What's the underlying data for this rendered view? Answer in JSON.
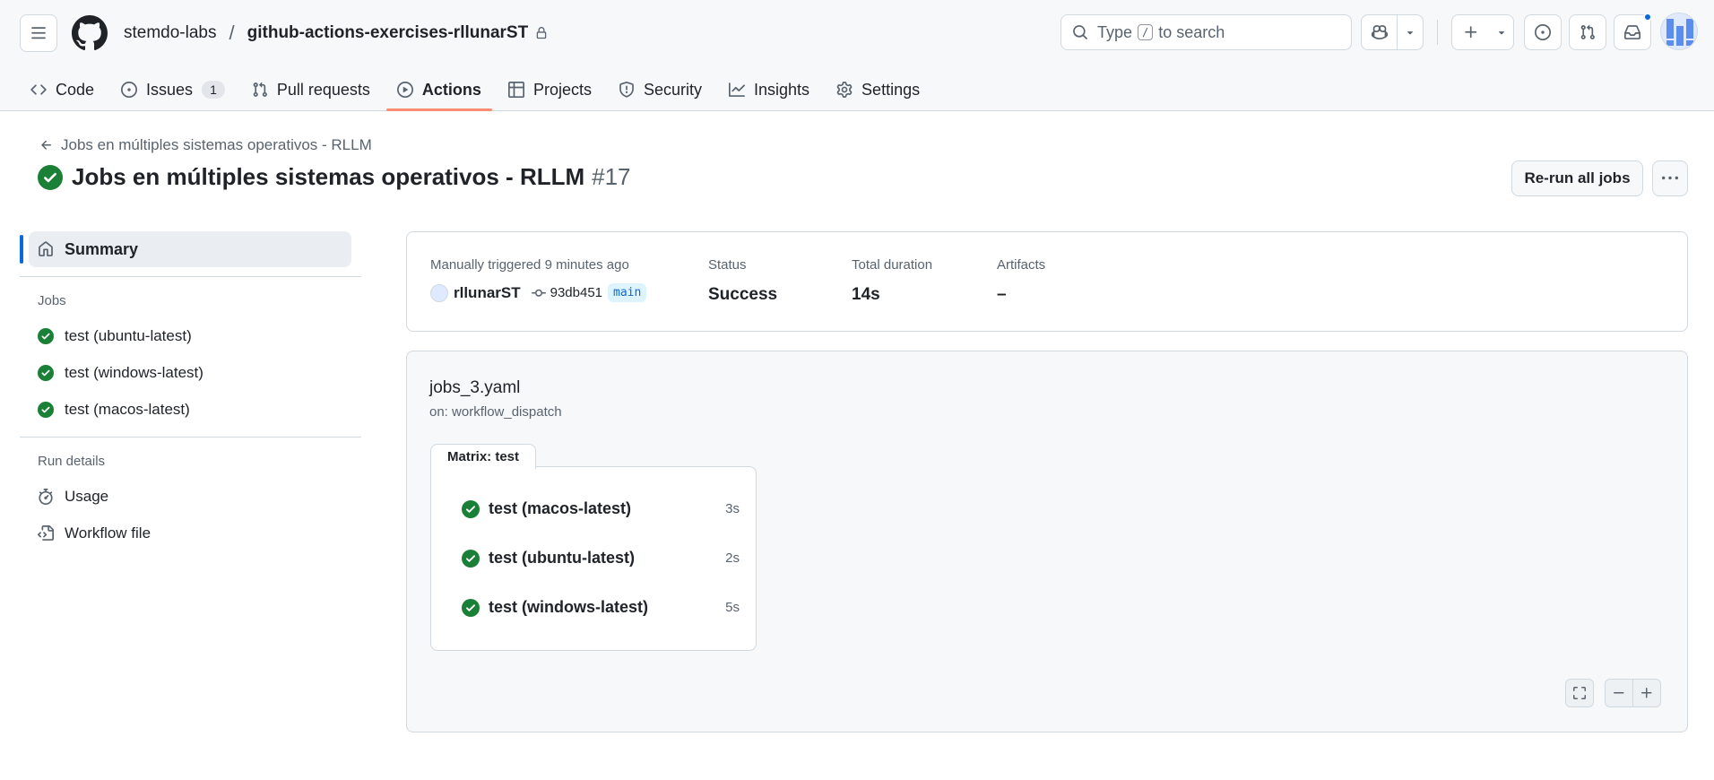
{
  "header": {
    "owner": "stemdo-labs",
    "separator": "/",
    "repo": "github-actions-exercises-rllunarST",
    "search_prefix": "Type",
    "search_key": "/",
    "search_suffix": "to search"
  },
  "tabs": [
    {
      "label": "Code",
      "icon": "code-icon"
    },
    {
      "label": "Issues",
      "icon": "issue-icon",
      "count": "1"
    },
    {
      "label": "Pull requests",
      "icon": "pull-request-icon"
    },
    {
      "label": "Actions",
      "icon": "play-icon",
      "active": true
    },
    {
      "label": "Projects",
      "icon": "table-icon"
    },
    {
      "label": "Security",
      "icon": "shield-icon"
    },
    {
      "label": "Insights",
      "icon": "graph-icon"
    },
    {
      "label": "Settings",
      "icon": "gear-icon"
    }
  ],
  "run": {
    "back_label": "Jobs en múltiples sistemas operativos - RLLM",
    "title": "Jobs en múltiples sistemas operativos - RLLM",
    "number": "#17",
    "rerun_label": "Re-run all jobs"
  },
  "sidebar": {
    "summary_label": "Summary",
    "jobs_heading": "Jobs",
    "jobs": [
      "test (ubuntu-latest)",
      "test (windows-latest)",
      "test (macos-latest)"
    ],
    "details_heading": "Run details",
    "usage_label": "Usage",
    "workflow_file_label": "Workflow file"
  },
  "summary": {
    "trigger_label": "Manually triggered 9 minutes ago",
    "actor": "rllunarST",
    "commit": "93db451",
    "branch": "main",
    "status_label": "Status",
    "status_value": "Success",
    "duration_label": "Total duration",
    "duration_value": "14s",
    "artifacts_label": "Artifacts",
    "artifacts_value": "–"
  },
  "graph": {
    "workflow_file": "jobs_3.yaml",
    "trigger": "on: workflow_dispatch",
    "matrix_label": "Matrix: test",
    "jobs": [
      {
        "name": "test (macos-latest)",
        "duration": "3s"
      },
      {
        "name": "test (ubuntu-latest)",
        "duration": "2s"
      },
      {
        "name": "test (windows-latest)",
        "duration": "5s"
      }
    ]
  },
  "colors": {
    "success": "#1a7f37",
    "accent": "#0969da",
    "active_tab_underline": "#fd8c73"
  }
}
